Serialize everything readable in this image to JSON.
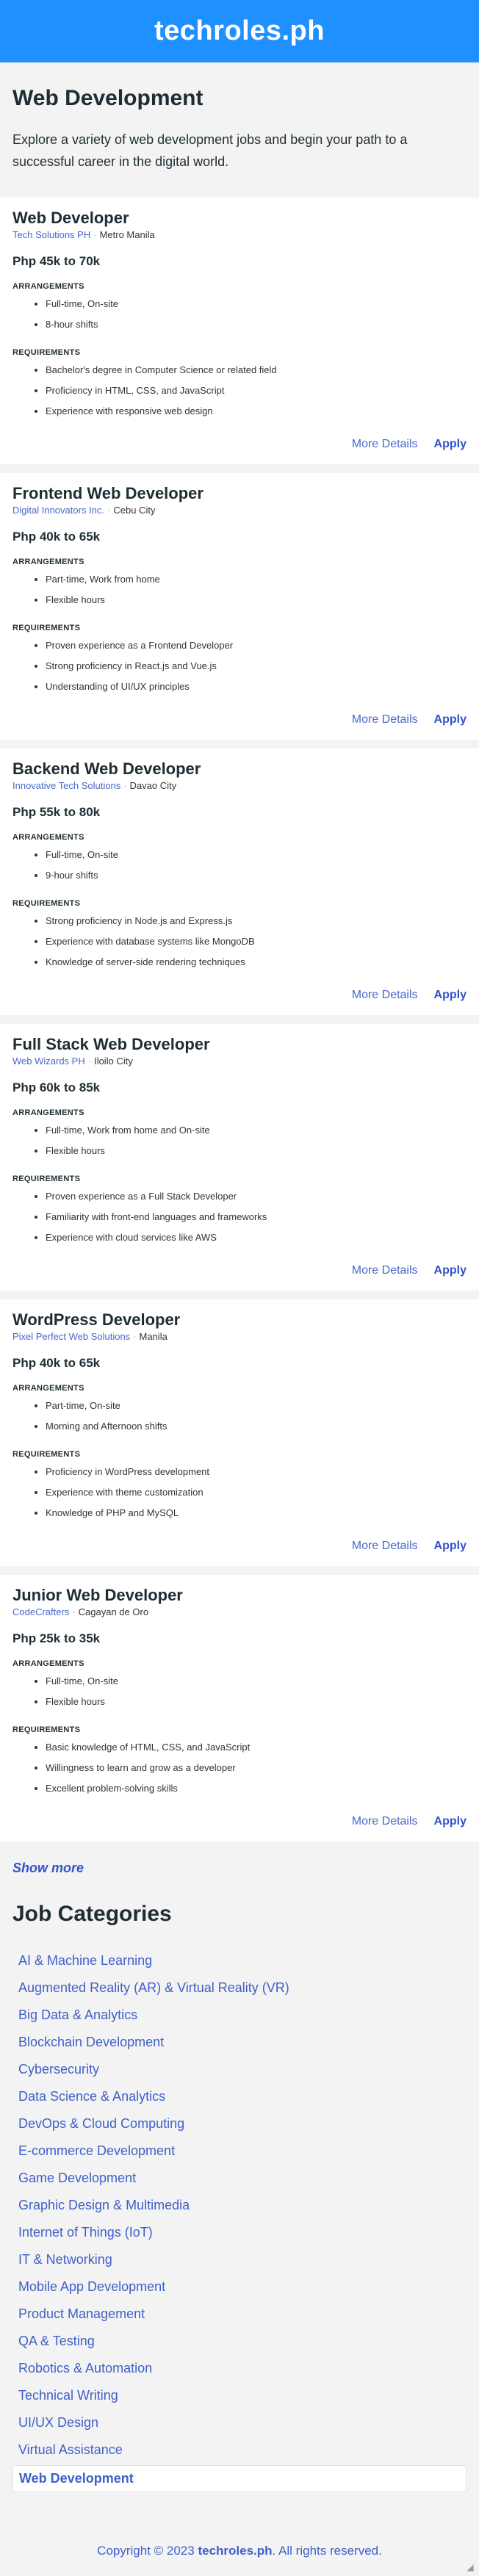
{
  "header": {
    "logo": "techroles.ph"
  },
  "intro": {
    "title": "Web Development",
    "description": "Explore a variety of web development jobs and begin your path to a successful career in the digital world."
  },
  "labels": {
    "arrangements": "ARRANGEMENTS",
    "requirements": "REQUIREMENTS",
    "more_details": "More Details",
    "apply": "Apply",
    "salary_prefix": "Php",
    "salary_to": "to",
    "meta_separator": "·"
  },
  "jobs": [
    {
      "title": "Web Developer",
      "company": "Tech Solutions PH",
      "location": "Metro Manila",
      "salary_min": "45k",
      "salary_max": "70k",
      "arrangements": [
        "Full-time, On-site",
        "8-hour shifts"
      ],
      "requirements": [
        "Bachelor's degree in Computer Science or related field",
        "Proficiency in HTML, CSS, and JavaScript",
        "Experience with responsive web design"
      ]
    },
    {
      "title": "Frontend Web Developer",
      "company": "Digital Innovators Inc.",
      "location": "Cebu City",
      "salary_min": "40k",
      "salary_max": "65k",
      "arrangements": [
        "Part-time, Work from home",
        "Flexible hours"
      ],
      "requirements": [
        "Proven experience as a Frontend Developer",
        "Strong proficiency in React.js and Vue.js",
        "Understanding of UI/UX principles"
      ]
    },
    {
      "title": "Backend Web Developer",
      "company": "Innovative Tech Solutions",
      "location": "Davao City",
      "salary_min": "55k",
      "salary_max": "80k",
      "arrangements": [
        "Full-time, On-site",
        "9-hour shifts"
      ],
      "requirements": [
        "Strong proficiency in Node.js and Express.js",
        "Experience with database systems like MongoDB",
        "Knowledge of server-side rendering techniques"
      ]
    },
    {
      "title": "Full Stack Web Developer",
      "company": "Web Wizards PH",
      "location": "Iloilo City",
      "salary_min": "60k",
      "salary_max": "85k",
      "arrangements": [
        "Full-time, Work from home and On-site",
        "Flexible hours"
      ],
      "requirements": [
        "Proven experience as a Full Stack Developer",
        "Familiarity with front-end languages and frameworks",
        "Experience with cloud services like AWS"
      ]
    },
    {
      "title": "WordPress Developer",
      "company": "Pixel Perfect Web Solutions",
      "location": "Manila",
      "salary_min": "40k",
      "salary_max": "65k",
      "arrangements": [
        "Part-time, On-site",
        "Morning and Afternoon shifts"
      ],
      "requirements": [
        "Proficiency in WordPress development",
        "Experience with theme customization",
        "Knowledge of PHP and MySQL"
      ]
    },
    {
      "title": "Junior Web Developer",
      "company": "CodeCrafters",
      "location": "Cagayan de Oro",
      "salary_min": "25k",
      "salary_max": "35k",
      "arrangements": [
        "Full-time, On-site",
        "Flexible hours"
      ],
      "requirements": [
        "Basic knowledge of HTML, CSS, and JavaScript",
        "Willingness to learn and grow as a developer",
        "Excellent problem-solving skills"
      ]
    }
  ],
  "show_more": "Show more",
  "categories": {
    "title": "Job Categories",
    "items": [
      "AI & Machine Learning",
      "Augmented Reality (AR) & Virtual Reality (VR)",
      "Big Data & Analytics",
      "Blockchain Development",
      "Cybersecurity",
      "Data Science & Analytics",
      "DevOps & Cloud Computing",
      "E-commerce Development",
      "Game Development",
      "Graphic Design & Multimedia",
      "Internet of Things (IoT)",
      "IT & Networking",
      "Mobile App Development",
      "Product Management",
      "QA & Testing",
      "Robotics & Automation",
      "Technical Writing",
      "UI/UX Design",
      "Virtual Assistance",
      "Web Development"
    ],
    "active": "Web Development"
  },
  "footer": {
    "prefix": "Copyright © 2023 ",
    "brand": "techroles.ph",
    "suffix": ". All rights reserved."
  },
  "icons": {
    "resize_grip": "resize-grip-icon"
  }
}
